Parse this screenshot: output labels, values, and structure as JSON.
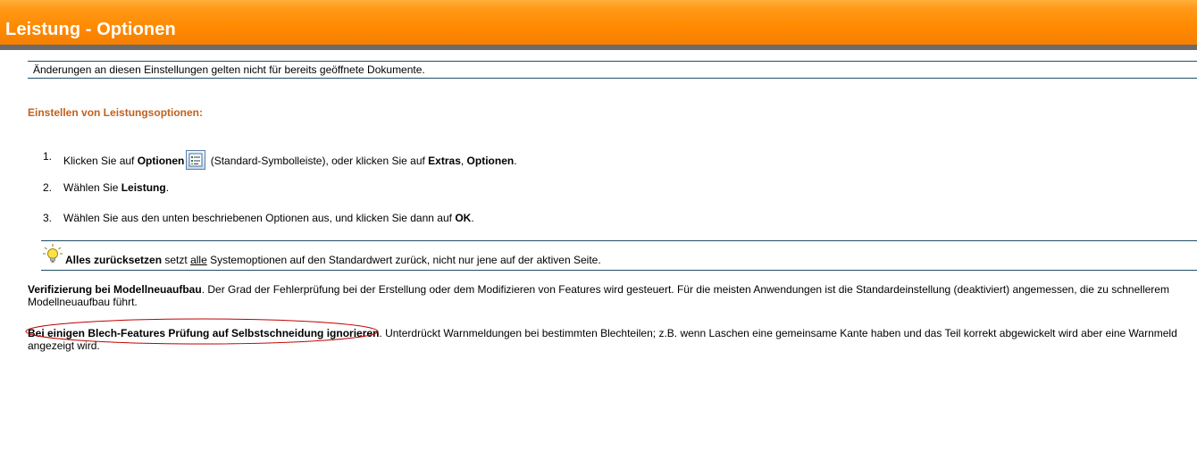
{
  "header": {
    "title": "Leistung - Optionen"
  },
  "note": {
    "text": "Änderungen an diesen Einstellungen gelten nicht für bereits geöffnete Dokumente."
  },
  "section": {
    "heading": "Einstellen von Leistungsoptionen:"
  },
  "steps": [
    {
      "num": "1.",
      "pre": "Klicken Sie auf ",
      "b1": "Optionen",
      "mid": " (Standard-Symbolleiste), oder klicken Sie auf ",
      "b2": "Extras",
      "sep": ", ",
      "b3": "Optionen",
      "end": "."
    },
    {
      "num": "2.",
      "pre": "Wählen Sie ",
      "b1": "Leistung",
      "end": "."
    },
    {
      "num": "3.",
      "pre": "Wählen Sie aus den unten beschriebenen Optionen aus, und klicken Sie dann auf ",
      "b1": "OK",
      "end": "."
    }
  ],
  "tip": {
    "bold": "Alles zurücksetzen",
    "pre": " setzt ",
    "underlined": "alle",
    "rest": " Systemoptionen auf den Standardwert zurück, nicht nur jene auf der aktiven Seite."
  },
  "options": [
    {
      "term": "Verifizierung bei Modellneuaufbau",
      "desc_line1": ". Der Grad der Fehlerprüfung bei der Erstellung oder dem Modifizieren von Features wird gesteuert. Für die meisten Anwendungen ist die Standardeinstellung (deaktiviert) angemessen, die zu schnellerem",
      "desc_line2": "Modellneuaufbau führt."
    },
    {
      "term": "Bei einigen Blech-Features Prüfung auf Selbstschneidung ignorieren",
      "desc_line1": ". Unterdrückt Warnmeldungen bei bestimmten Blechteilen; z.B. wenn Laschen eine gemeinsame Kante haben und das Teil korrekt abgewickelt wird aber eine Warnmeld",
      "desc_line2": "angezeigt wird."
    }
  ],
  "colors": {
    "header_orange": "#ff8a00",
    "header_bar": "#6b6b6b",
    "heading_brown": "#c0611e",
    "rule": "#1f4f66",
    "annotation_red": "#c00000"
  },
  "icons": {
    "options": "options-icon",
    "tip": "lightbulb-icon"
  }
}
